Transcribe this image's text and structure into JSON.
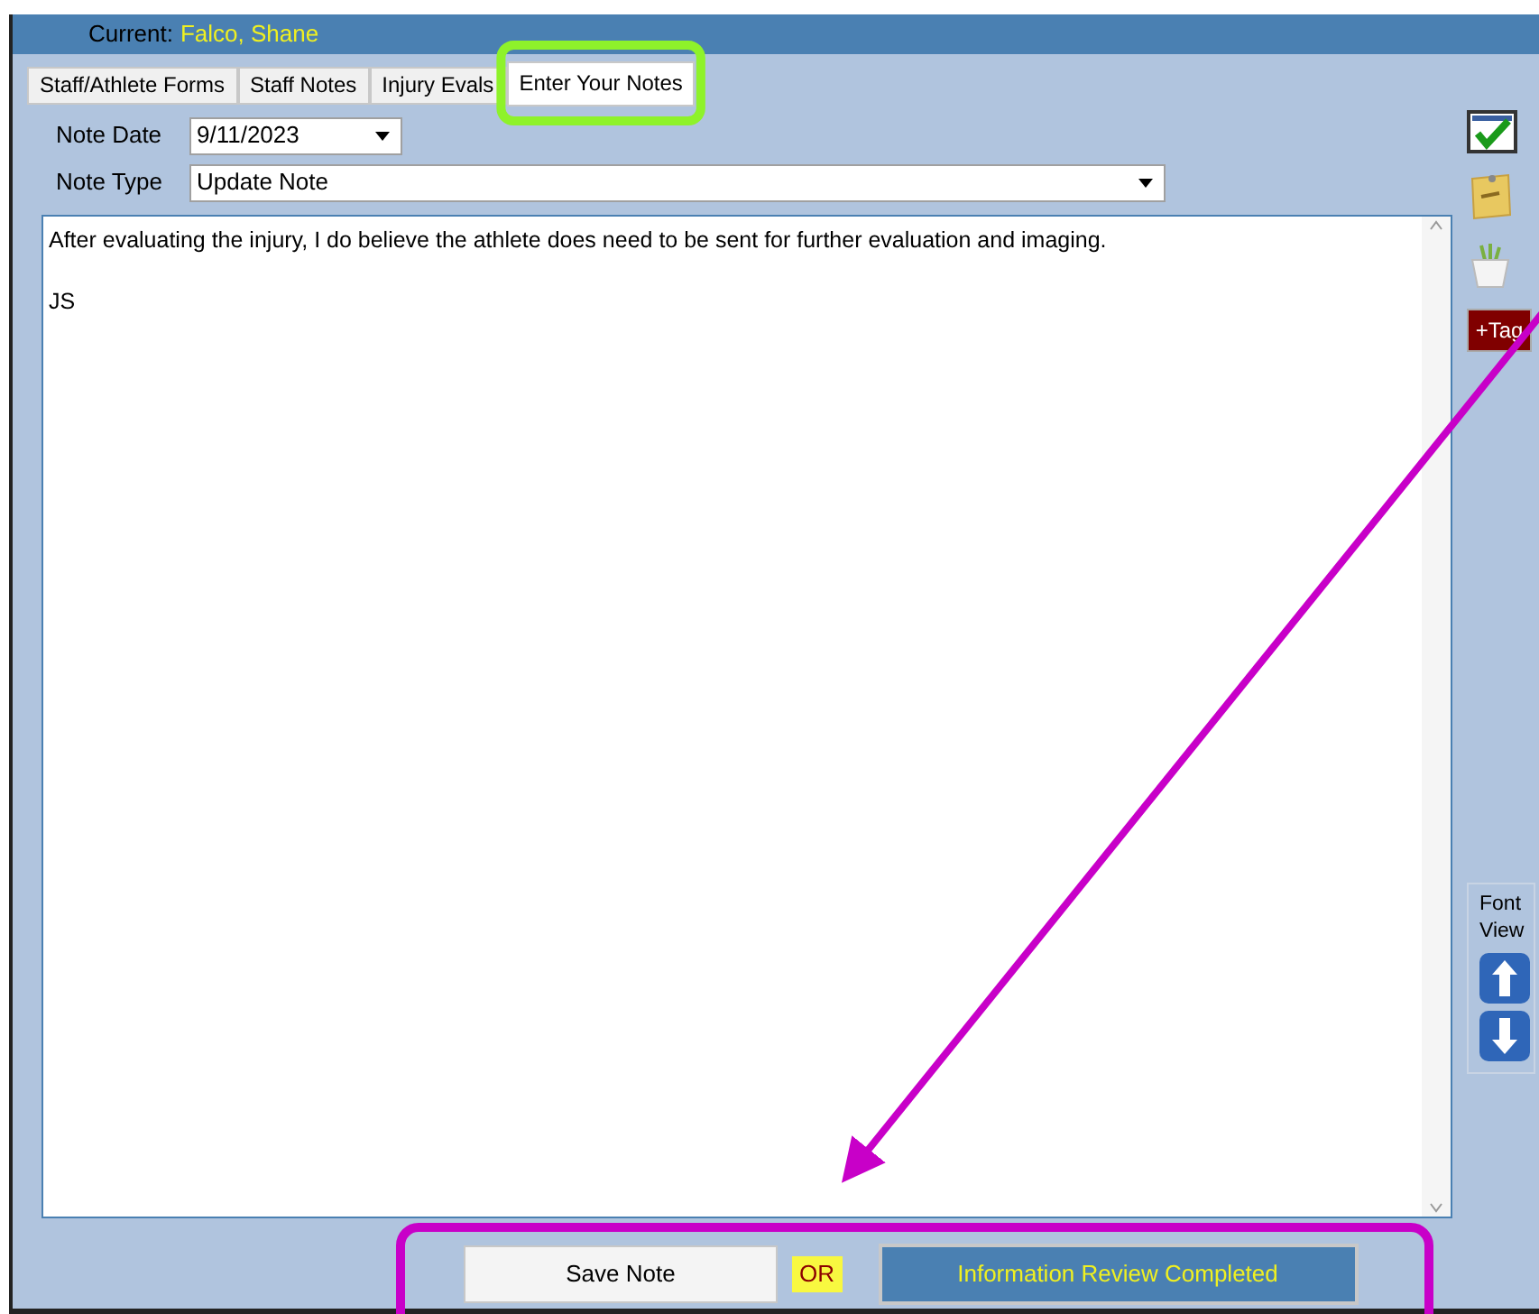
{
  "header": {
    "label": "Current:",
    "name": "Falco, Shane"
  },
  "tabs": [
    {
      "label": "Staff/Athlete Forms",
      "selected": false
    },
    {
      "label": "Staff Notes",
      "selected": false
    },
    {
      "label": "Injury Evals",
      "selected": false
    },
    {
      "label": "Enter Your Notes",
      "selected": true
    }
  ],
  "fields": [
    {
      "label": "Note Date",
      "value": "9/11/2023",
      "kind": "short"
    },
    {
      "label": "Note Type",
      "value": "Update Note",
      "kind": "long"
    }
  ],
  "note_text": [
    "After evaluating the injury, I do believe the athlete does need to be sent for further evaluation and imaging.",
    "JS"
  ],
  "sidebar": {
    "tag_button": "+Tag",
    "font_view_label": [
      "Font",
      "View"
    ]
  },
  "buttons": {
    "save": "Save Note",
    "or": "OR",
    "review": "Information Review Completed"
  }
}
